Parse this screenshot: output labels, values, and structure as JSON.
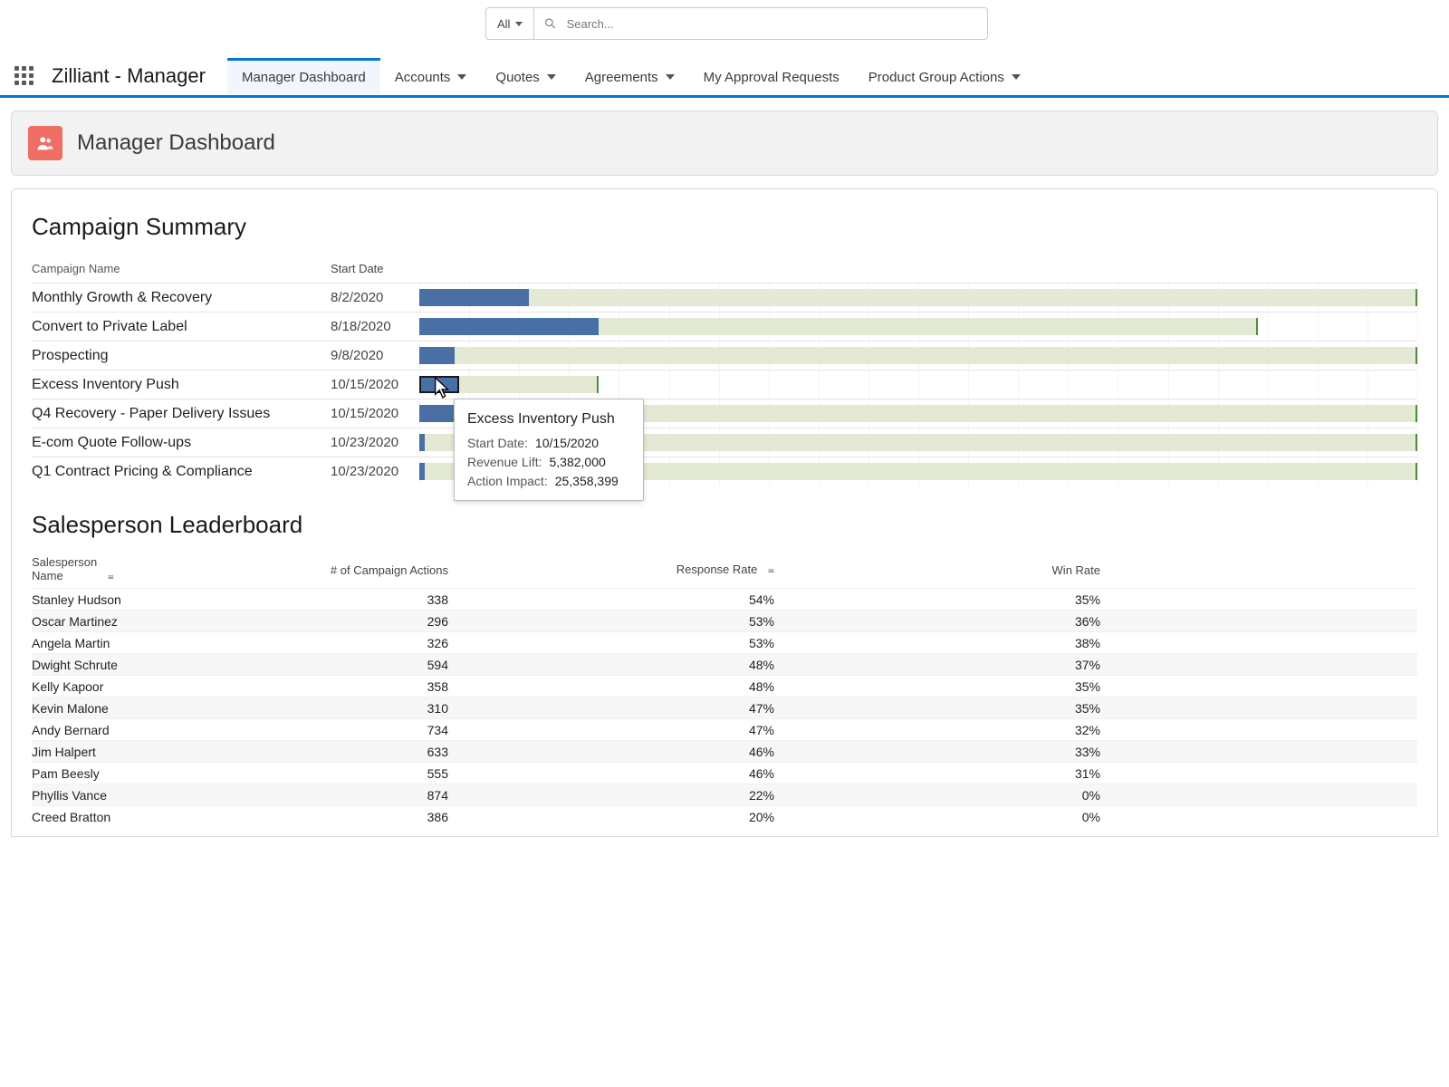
{
  "search": {
    "scope_label": "All",
    "placeholder": "Search..."
  },
  "app_title": "Zilliant - Manager",
  "nav": [
    {
      "label": "Manager Dashboard",
      "active": true,
      "dropdown": false
    },
    {
      "label": "Accounts",
      "active": false,
      "dropdown": true
    },
    {
      "label": "Quotes",
      "active": false,
      "dropdown": true
    },
    {
      "label": "Agreements",
      "active": false,
      "dropdown": true
    },
    {
      "label": "My Approval Requests",
      "active": false,
      "dropdown": false
    },
    {
      "label": "Product Group Actions",
      "active": false,
      "dropdown": true
    }
  ],
  "page_header_title": "Manager Dashboard",
  "campaign_section_title": "Campaign Summary",
  "campaign_columns": {
    "name": "Campaign Name",
    "date": "Start Date"
  },
  "campaigns": [
    {
      "name": "Monthly Growth & Recovery",
      "date": "8/2/2020",
      "track_pct": 100,
      "fill_pct": 11
    },
    {
      "name": "Convert to Private Label",
      "date": "8/18/2020",
      "track_pct": 84,
      "fill_pct": 18
    },
    {
      "name": "Prospecting",
      "date": "9/8/2020",
      "track_pct": 100,
      "fill_pct": 3.5
    },
    {
      "name": "Excess Inventory Push",
      "date": "10/15/2020",
      "track_pct": 18,
      "fill_pct": 4,
      "selected": true
    },
    {
      "name": "Q4 Recovery - Paper Delivery Issues",
      "date": "10/15/2020",
      "track_pct": 100,
      "fill_pct": 4
    },
    {
      "name": "E-com Quote Follow-ups",
      "date": "10/23/2020",
      "track_pct": 100,
      "fill_pct": 0.5
    },
    {
      "name": "Q1 Contract Pricing & Compliance",
      "date": "10/23/2020",
      "track_pct": 100,
      "fill_pct": 0.5
    }
  ],
  "tooltip": {
    "title": "Excess Inventory Push",
    "rows": [
      {
        "label": "Start Date:",
        "value": "10/15/2020"
      },
      {
        "label": "Revenue Lift:",
        "value": "5,382,000"
      },
      {
        "label": "Action Impact:",
        "value": "25,358,399"
      }
    ]
  },
  "leaderboard_section_title": "Salesperson Leaderboard",
  "leaderboard_columns": {
    "name": "Salesperson\nName",
    "actions": "# of Campaign Actions",
    "response": "Response Rate",
    "win": "Win Rate"
  },
  "leaderboard": [
    {
      "name": "Stanley Hudson",
      "actions": "338",
      "response": "54%",
      "win": "35%"
    },
    {
      "name": "Oscar Martinez",
      "actions": "296",
      "response": "53%",
      "win": "36%"
    },
    {
      "name": "Angela Martin",
      "actions": "326",
      "response": "53%",
      "win": "38%"
    },
    {
      "name": "Dwight Schrute",
      "actions": "594",
      "response": "48%",
      "win": "37%"
    },
    {
      "name": "Kelly Kapoor",
      "actions": "358",
      "response": "48%",
      "win": "35%"
    },
    {
      "name": "Kevin Malone",
      "actions": "310",
      "response": "47%",
      "win": "35%"
    },
    {
      "name": "Andy Bernard",
      "actions": "734",
      "response": "47%",
      "win": "32%"
    },
    {
      "name": "Jim Halpert",
      "actions": "633",
      "response": "46%",
      "win": "33%"
    },
    {
      "name": "Pam Beesly",
      "actions": "555",
      "response": "46%",
      "win": "31%"
    },
    {
      "name": "Phyllis Vance",
      "actions": "874",
      "response": "22%",
      "win": "0%"
    },
    {
      "name": "Creed Bratton",
      "actions": "386",
      "response": "20%",
      "win": "0%"
    }
  ],
  "chart_data": {
    "type": "bar",
    "title": "Campaign Summary",
    "categories": [
      "Monthly Growth & Recovery",
      "Convert to Private Label",
      "Prospecting",
      "Excess Inventory Push",
      "Q4 Recovery - Paper Delivery Issues",
      "E-com Quote Follow-ups",
      "Q1 Contract Pricing & Compliance"
    ],
    "series": [
      {
        "name": "Action Impact (track)",
        "values": [
          100,
          84,
          100,
          18,
          100,
          100,
          100
        ]
      },
      {
        "name": "Revenue Lift (fill)",
        "values": [
          11,
          18,
          3.5,
          4,
          4,
          0.5,
          0.5
        ]
      }
    ],
    "xlabel": "",
    "ylabel": ""
  }
}
